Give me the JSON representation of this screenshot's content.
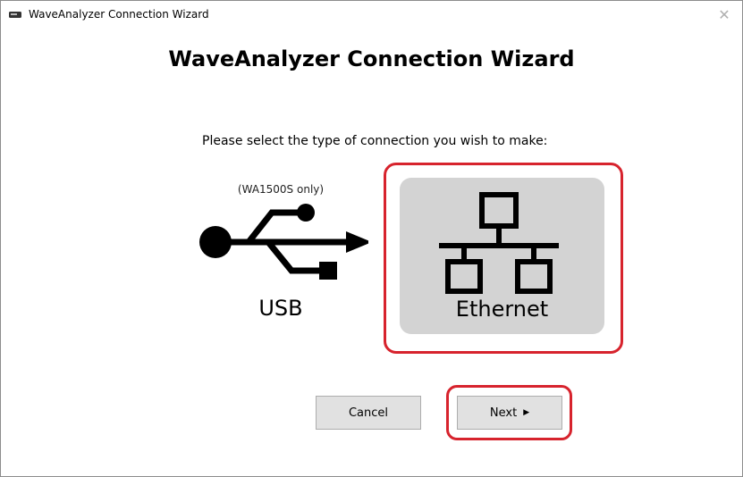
{
  "window": {
    "title": "WaveAnalyzer Connection Wizard"
  },
  "heading": "WaveAnalyzer Connection Wizard",
  "prompt": "Please select the type of connection you wish to make:",
  "options": {
    "usb": {
      "note": "(WA1500S only)",
      "label": "USB",
      "icon": "usb-icon"
    },
    "ethernet": {
      "label": "Ethernet",
      "icon": "network-icon",
      "selected": true
    }
  },
  "buttons": {
    "cancel": "Cancel",
    "next": "Next",
    "next_arrow": "▶"
  },
  "colors": {
    "highlight": "#d7232d",
    "selected_bg": "#d3d3d3",
    "button_bg": "#e1e1e1"
  }
}
